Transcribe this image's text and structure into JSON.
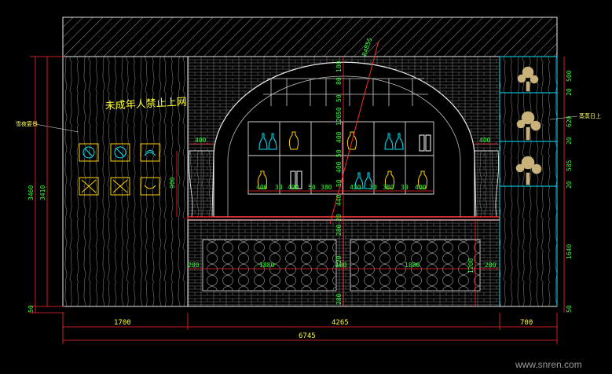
{
  "drawing": {
    "slogan": "未成年人禁止上网",
    "left_note": "雪夜宴景",
    "right_note": "蒸蒸日上",
    "diag_label": "R4855",
    "watermark": "www.snren.com"
  },
  "dims_bottom": {
    "left": "1700",
    "mid": "4265",
    "right": "700",
    "total": "6745"
  },
  "dims_left": {
    "outer": "3460",
    "inner": "3410",
    "base": "50"
  },
  "dims_right": [
    "500",
    "20",
    "620",
    "20",
    "585",
    "20",
    "1640",
    "50"
  ],
  "dims_center_v": [
    "100",
    "80",
    "50",
    "50",
    "120",
    "400",
    "50",
    "400",
    "50",
    "440",
    "20",
    "280",
    "120",
    "280"
  ],
  "dims_shelf": [
    "400",
    "30",
    "400",
    "50",
    "380",
    "430",
    "30",
    "380",
    "30",
    "400"
  ],
  "dims_counter": [
    "200",
    "1880",
    "100",
    "1880",
    "200"
  ],
  "dims_misc": {
    "left_pillar_h": "900",
    "left_top": "400",
    "right_top": "400",
    "counter_h": "1200"
  },
  "colors": {
    "line": "#e8e8e8",
    "dim": "#ff2a2a",
    "text_green": "#33ff33",
    "text_yellow": "#ffff33",
    "cyan": "#00e5ff"
  }
}
